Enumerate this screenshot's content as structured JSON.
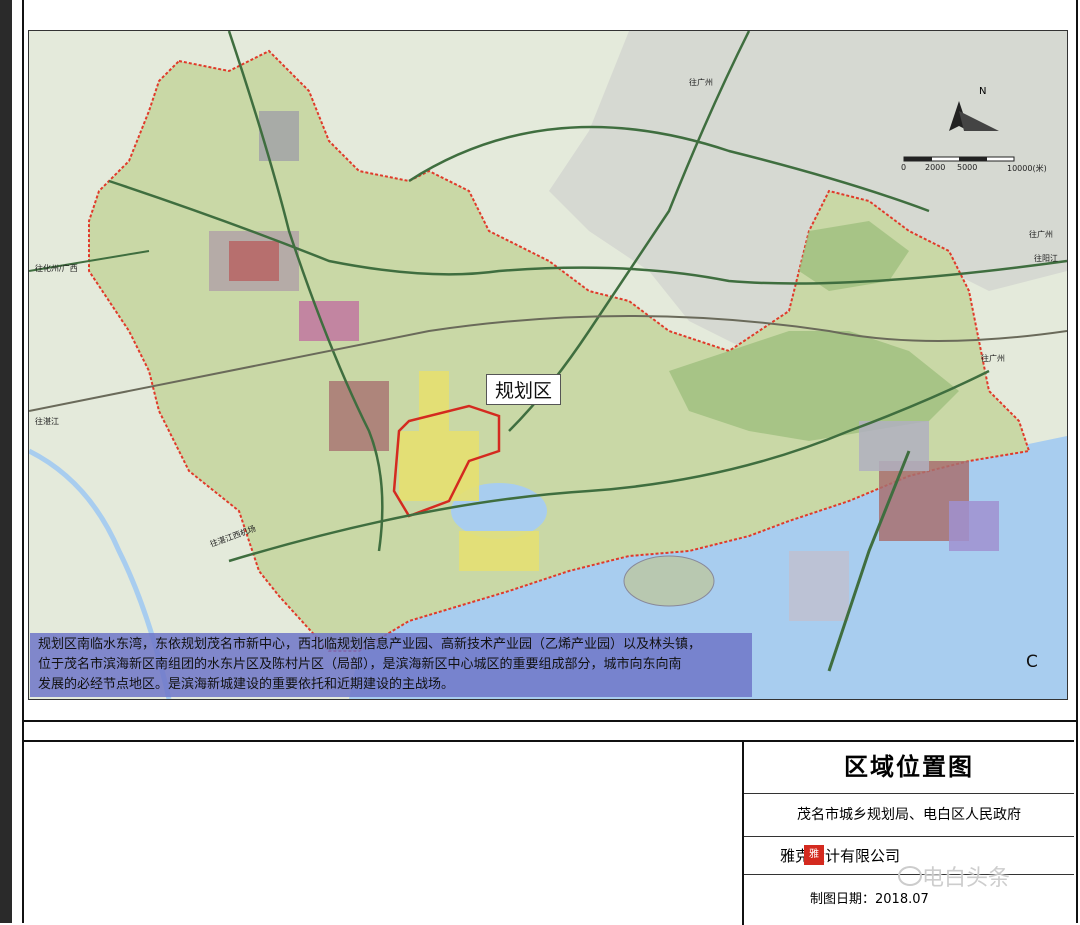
{
  "map": {
    "planning_area_label": "规划区",
    "corner_mark": "C",
    "north_label": "N",
    "scale_labels": [
      "0",
      "2000",
      "5000",
      "10000(米)"
    ],
    "road_labels": {
      "to_guangzhou_top": "往广州",
      "to_huazhou": "往化州/广西",
      "to_zhanjiang": "往湛江",
      "to_guangzhou_right": "往广州",
      "to_yangjiang": "往阳江",
      "to_guangzhou_lower": "往广州",
      "to_airport": "往湛江西机场"
    },
    "description_lines": [
      "规划区南临水东湾，东依规划茂名市新中心，西北临规划信息产业园、高新技术产业园（乙烯产业园）以及林头镇，",
      "位于茂名市滨海新区南组团的水东片区及陈村片区（局部），是滨海新区中心城区的重要组成部分，城市向东向南",
      "发展的必经节点地区。是滨海新城建设的重要依托和近期建设的主战场。"
    ]
  },
  "title_block": {
    "title": "区域位置图",
    "organization": "茂名市城乡规划局、电白区人民政府",
    "company": "雅克设计有限公司",
    "date": "制图日期：2018.07",
    "logo_text": "雅"
  },
  "watermark": "电白头条",
  "colors": {
    "sea": "#a8cdef",
    "land": "#c9d8a6",
    "boundary": "#e03a2a",
    "planning_boundary": "#d42a1f",
    "roads": "#3f6e3f",
    "description_bg": "#6e76c8"
  }
}
